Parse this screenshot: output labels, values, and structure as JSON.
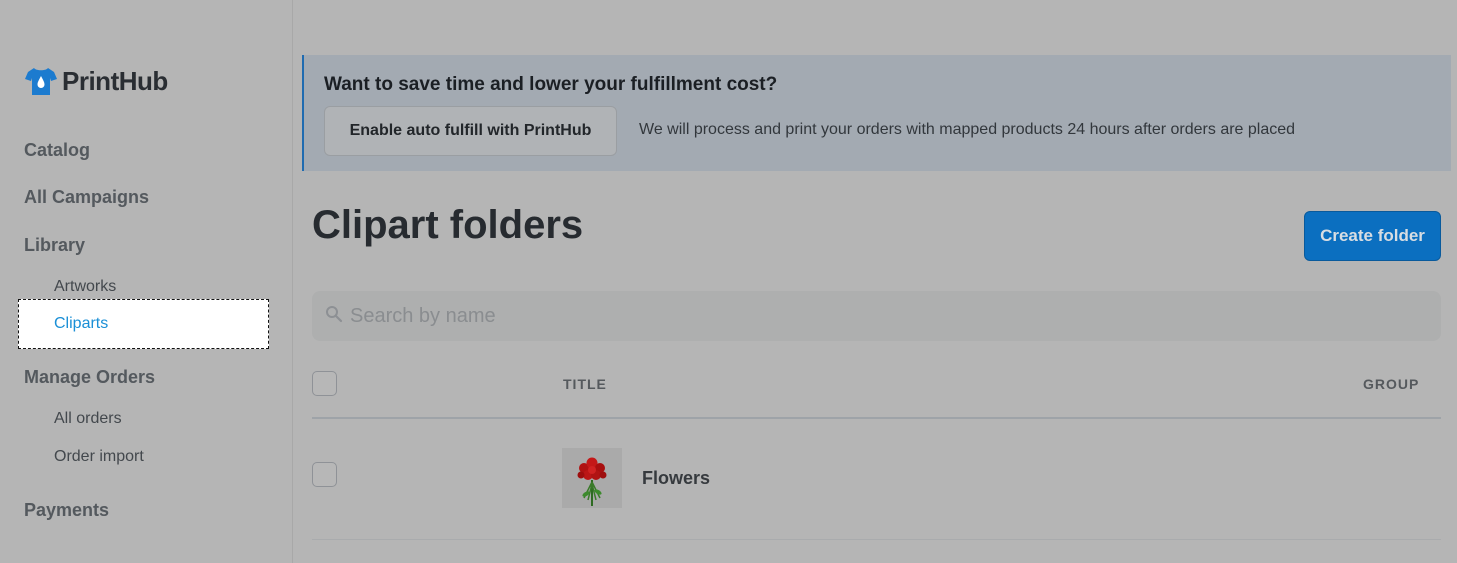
{
  "brand": {
    "name": "PrintHub"
  },
  "sidebar": {
    "sections": [
      {
        "label": "Catalog"
      },
      {
        "label": "All Campaigns"
      },
      {
        "label": "Library",
        "items": [
          {
            "label": "Artworks"
          },
          {
            "label": "Cliparts",
            "selected": true
          }
        ]
      },
      {
        "label": "Manage Orders",
        "items": [
          {
            "label": "All orders"
          },
          {
            "label": "Order import"
          }
        ]
      },
      {
        "label": "Payments"
      }
    ]
  },
  "banner": {
    "title": "Want to save time and lower your fulfillment cost?",
    "button_label": "Enable auto fulfill with PrintHub",
    "description": "We will process and print your orders with mapped products 24 hours after orders are placed"
  },
  "page": {
    "title": "Clipart folders",
    "create_button": "Create folder",
    "search_placeholder": "Search by name"
  },
  "table": {
    "columns": [
      "TITLE",
      "GROUP"
    ],
    "rows": [
      {
        "title": "Flowers",
        "group": "",
        "thumbnail": "red-roses-bouquet"
      }
    ]
  },
  "colors": {
    "accent": "#0b6fc0",
    "selected_link": "#1a8fd6",
    "banner_bg": "#a3aab2"
  }
}
